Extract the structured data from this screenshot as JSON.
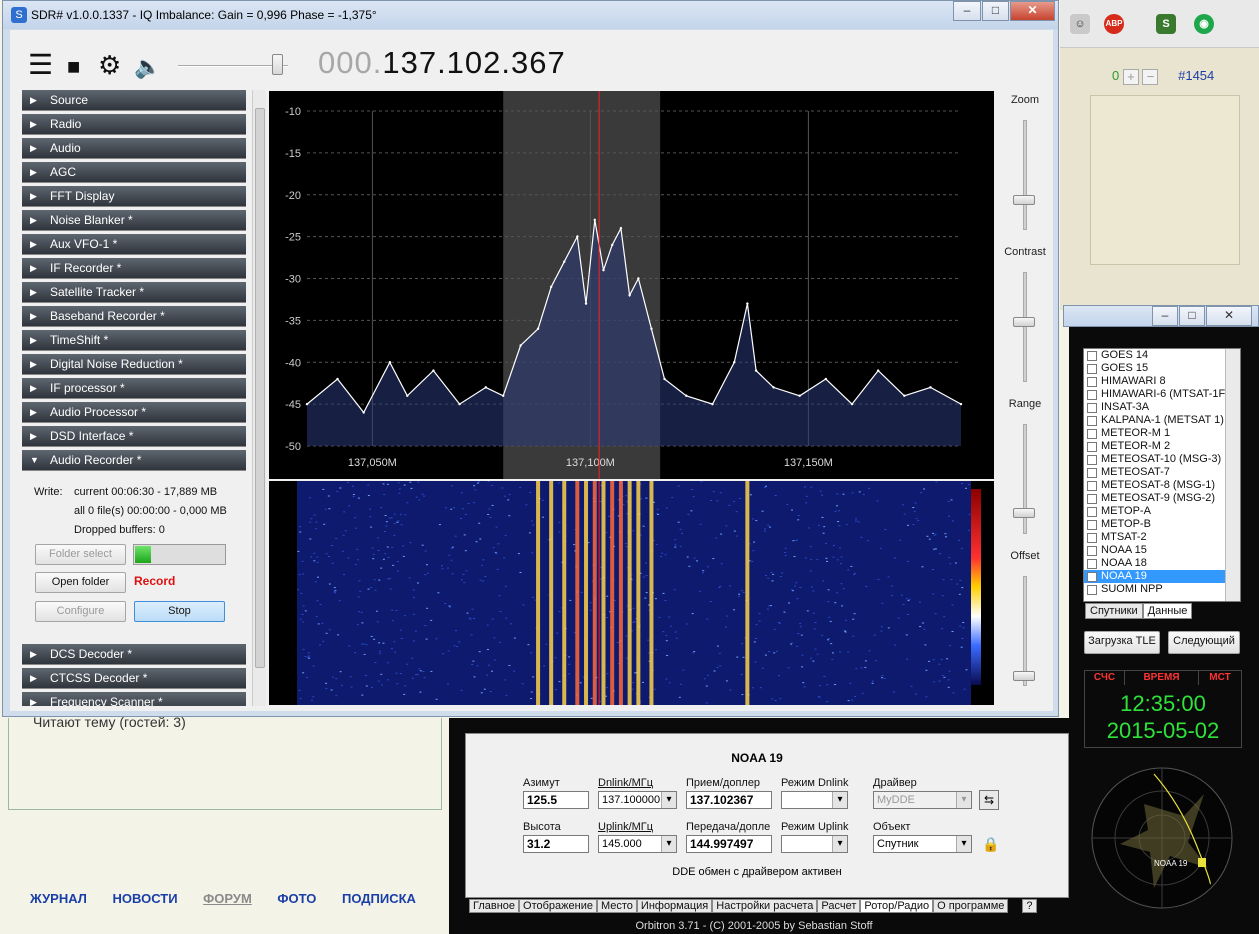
{
  "browser": {
    "forum_count": "0",
    "forum_plus": "+",
    "forum_minus": "−",
    "forum_id": "#1454",
    "readers_text": "Читают тему (гостей: 3)",
    "nav": [
      "ЖУРНАЛ",
      "НОВОСТИ",
      "ФОРУМ",
      "ФОТО",
      "ПОДПИСКА"
    ],
    "toolbar_icons": [
      "smiley-icon",
      "adblock-icon",
      "s-icon",
      "green-circle-icon"
    ]
  },
  "sdr": {
    "title": "SDR# v1.0.0.1337 - IQ Imbalance: Gain = 0,996 Phase = -1,375°",
    "freq_prefix": "000.",
    "freq_main": "137.102.367",
    "volume_level": 0.92,
    "plugins_top": [
      "Source",
      "Radio",
      "Audio",
      "AGC",
      "FFT Display",
      "Noise Blanker *",
      "Aux VFO-1 *",
      "IF Recorder *",
      "Satellite Tracker *",
      "Baseband Recorder *",
      "TimeShift *",
      "Digital Noise Reduction *",
      "IF processor *",
      "Audio Processor *",
      "DSD Interface *",
      "Audio Recorder *"
    ],
    "plugins_bottom": [
      "DCS Decoder *",
      "CTCSS Decoder *",
      "Frequency Scanner *"
    ],
    "recorder": {
      "write_label": "Write:",
      "current": "current 00:06:30 - 17,889 MB",
      "all": "all 0 file(s) 00:00:00 - 0,000 MB",
      "dropped": "Dropped buffers: 0",
      "folder_select": "Folder select",
      "open_folder": "Open folder",
      "record": "Record",
      "configure": "Configure",
      "stop": "Stop",
      "level": 0.18
    },
    "sliders": {
      "zoom": "Zoom",
      "contrast": "Contrast",
      "range": "Range",
      "offset": "Offset",
      "zoom_level": 0.25,
      "contrast_level": 0.55,
      "range_level": 0.16,
      "offset_level": 0.05
    },
    "colors": {
      "spectrum_line": "#ffffff",
      "center_line": "#ff2020",
      "grid": "#555555",
      "waterfall_bg": "#0d1a6e"
    }
  },
  "chart_data": {
    "type": "line",
    "xlabel": "",
    "ylabel": "",
    "x_ticks": [
      "137,050M",
      "137,100M",
      "137,150M"
    ],
    "x_tick_values": [
      137.05,
      137.1,
      137.15
    ],
    "xlim": [
      137.035,
      137.185
    ],
    "ylim": [
      -50,
      -10
    ],
    "y_ticks": [
      -10,
      -15,
      -20,
      -25,
      -30,
      -35,
      -40,
      -45,
      -50
    ],
    "center_freq": 137.102,
    "passband": [
      137.08,
      137.116
    ],
    "grid": true,
    "series": [
      {
        "x": [
          137.035,
          137.042,
          137.048,
          137.054,
          137.058,
          137.064,
          137.07,
          137.076,
          137.08,
          137.084,
          137.088,
          137.091,
          137.094,
          137.097,
          137.099,
          137.101,
          137.103,
          137.105,
          137.107,
          137.109,
          137.111,
          137.114,
          137.117,
          137.122,
          137.128,
          137.133,
          137.136,
          137.138,
          137.142,
          137.148,
          137.154,
          137.16,
          137.166,
          137.172,
          137.178,
          137.185
        ],
        "values": [
          -45,
          -42,
          -46,
          -40,
          -44,
          -41,
          -45,
          -43,
          -44,
          -38,
          -36,
          -31,
          -28,
          -25,
          -33,
          -23,
          -29,
          -26,
          -24,
          -32,
          -30,
          -36,
          -42,
          -44,
          -45,
          -40,
          -33,
          -41,
          -43,
          -44,
          -42,
          -45,
          -41,
          -44,
          -43,
          -45
        ]
      }
    ]
  },
  "orbitron": {
    "satellites": [
      {
        "name": "GOES 14",
        "checked": false
      },
      {
        "name": "GOES 15",
        "checked": false
      },
      {
        "name": "HIMAWARI 8",
        "checked": false
      },
      {
        "name": "HIMAWARI-6 (MTSAT-1F",
        "checked": false
      },
      {
        "name": "INSAT-3A",
        "checked": false
      },
      {
        "name": "KALPANA-1 (METSAT 1)",
        "checked": false
      },
      {
        "name": "METEOR-M 1",
        "checked": false
      },
      {
        "name": "METEOR-M 2",
        "checked": false
      },
      {
        "name": "METEOSAT-10 (MSG-3)",
        "checked": false
      },
      {
        "name": "METEOSAT-7",
        "checked": false
      },
      {
        "name": "METEOSAT-8 (MSG-1)",
        "checked": false
      },
      {
        "name": "METEOSAT-9 (MSG-2)",
        "checked": false
      },
      {
        "name": "METOP-A",
        "checked": false
      },
      {
        "name": "METOP-B",
        "checked": false
      },
      {
        "name": "MTSAT-2",
        "checked": false
      },
      {
        "name": "NOAA 15",
        "checked": false
      },
      {
        "name": "NOAA 18",
        "checked": false
      },
      {
        "name": "NOAA 19",
        "checked": true,
        "selected": true
      },
      {
        "name": "SUOMI NPP",
        "checked": false
      }
    ],
    "list_tabs": [
      "Спутники",
      "Данные"
    ],
    "btn_tle": "Загрузка TLE",
    "btn_next": "Следующий",
    "clock_heads": [
      "СЧС",
      "ВРЕМЯ",
      "МСТ"
    ],
    "time": "12:35:00",
    "date": "2015-05-02",
    "radar_label": "NOAA 19",
    "sat_name": "NOAA 19",
    "az_label": "Азимут",
    "az_value": "125.5",
    "el_label": "Высота",
    "el_value": "31.2",
    "dnlink_label": "Dnlink/МГц",
    "dnlink_value": "137.100000",
    "uplink_label": "Uplink/МГц",
    "uplink_value": "145.000",
    "rx_label": "Прием/доплер",
    "rx_value": "137.102367",
    "tx_label": "Передача/допле",
    "tx_value": "144.997497",
    "mode_dn_label": "Режим Dnlink",
    "mode_up_label": "Режим Uplink",
    "driver_label": "Драйвер",
    "driver_value": "MyDDE",
    "object_label": "Объект",
    "object_value": "Спутник",
    "status": "DDE обмен с драйвером активен",
    "tabs": [
      "Главное",
      "Отображение",
      "Место",
      "Информация",
      "Настройки расчета",
      "Расчет",
      "Ротор/Радио",
      "О программе",
      "?"
    ],
    "footer": "Orbitron 3.71 - (C) 2001-2005 by Sebastian Stoff"
  }
}
